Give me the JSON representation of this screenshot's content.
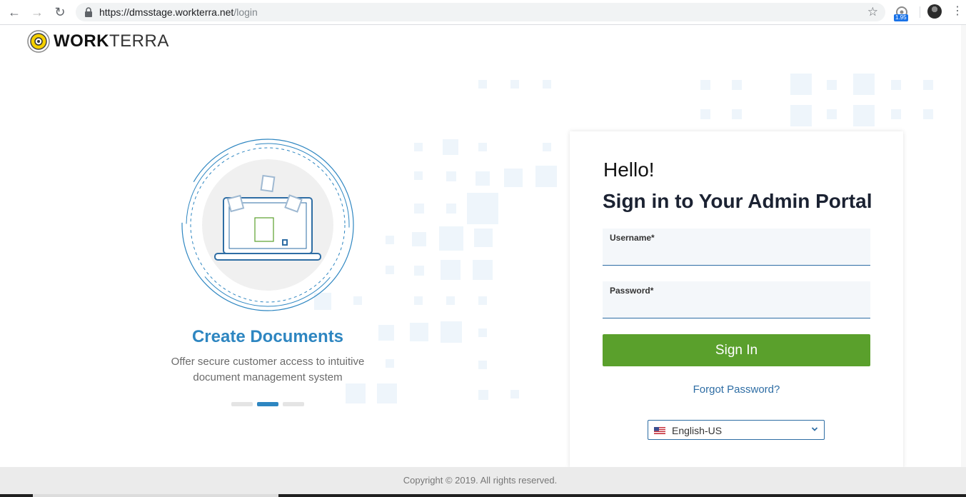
{
  "browser": {
    "url_host": "https://dmsstage.workterra.net",
    "url_path": "/login",
    "extension_badge": "1.95"
  },
  "logo": {
    "work": "WORK",
    "terra": "TERRA"
  },
  "carousel": {
    "title": "Create Documents",
    "description": "Offer secure customer access to intuitive document management system",
    "active_index": 1,
    "total_slides": 3
  },
  "login": {
    "greeting": "Hello!",
    "title": "Sign in to Your Admin Portal",
    "username_label": "Username*",
    "password_label": "Password*",
    "username_value": "",
    "password_value": "",
    "signin_label": "Sign In",
    "forgot_label": "Forgot Password?",
    "language": "English-US"
  },
  "footer": {
    "copyright": "Copyright © 2019. All rights reserved."
  },
  "colors": {
    "accent_blue": "#2e86c1",
    "signin_green": "#5aa02c",
    "link_blue": "#2e6da4",
    "field_bg": "#f4f7fa"
  },
  "icons": [
    "back-arrow-icon",
    "forward-arrow-icon",
    "reload-icon",
    "lock-icon",
    "star-icon",
    "extension-icon",
    "kebab-menu-icon",
    "us-flag-icon",
    "chevron-down-icon"
  ]
}
